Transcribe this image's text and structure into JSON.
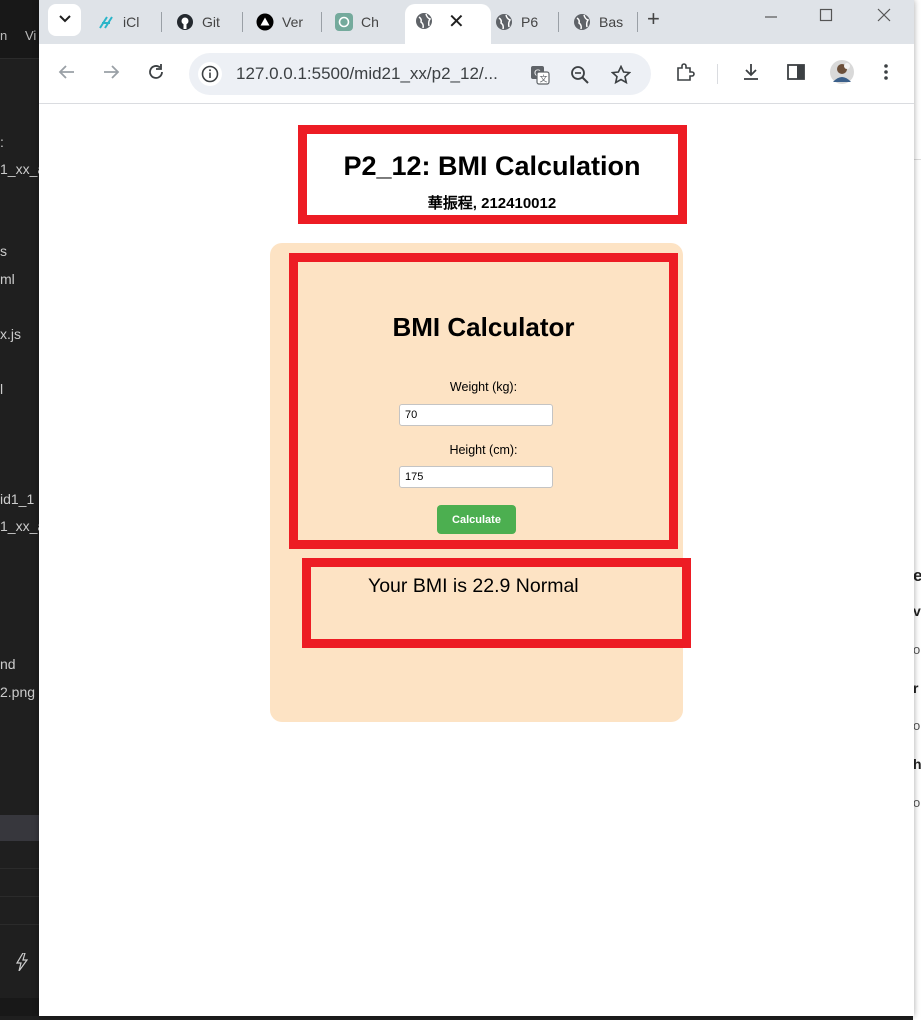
{
  "background_editor": {
    "menu_fragments": [
      "n",
      "Vi"
    ],
    "explorer_fragments": [
      ":",
      "1_xx_a",
      "s",
      "ml",
      "x.js",
      "l",
      "id1_1",
      "1_xx_a",
      "nd",
      "2.png"
    ],
    "right_fragments": [
      "e",
      "v",
      "or",
      "r",
      "or",
      "h",
      "or"
    ]
  },
  "browser": {
    "tabs": [
      {
        "label": "iCl",
        "icon": "icloud-tool-icon"
      },
      {
        "label": "Git",
        "icon": "github-icon"
      },
      {
        "label": "Ver",
        "icon": "vercel-icon"
      },
      {
        "label": "Ch",
        "icon": "chatgpt-icon"
      },
      {
        "label": "",
        "icon": "globe-icon",
        "active": true
      },
      {
        "label": "P6",
        "icon": "globe-icon"
      },
      {
        "label": "Bas",
        "icon": "globe-icon"
      }
    ],
    "address": "127.0.0.1:5500/mid21_xx/p2_12/..."
  },
  "page": {
    "header_title": "P2_12: BMI Calculation",
    "header_subtitle": "華振程, 212410012",
    "calculator": {
      "title": "BMI Calculator",
      "weight_label": "Weight (kg):",
      "weight_value": "70",
      "height_label": "Height (cm):",
      "height_value": "175",
      "button_label": "Calculate"
    },
    "result_text": "Your BMI is 22.9 Normal"
  },
  "colors": {
    "annotation_red": "#ed1c24",
    "panel_bg": "#fde3c4",
    "button_green": "#4caf50"
  }
}
